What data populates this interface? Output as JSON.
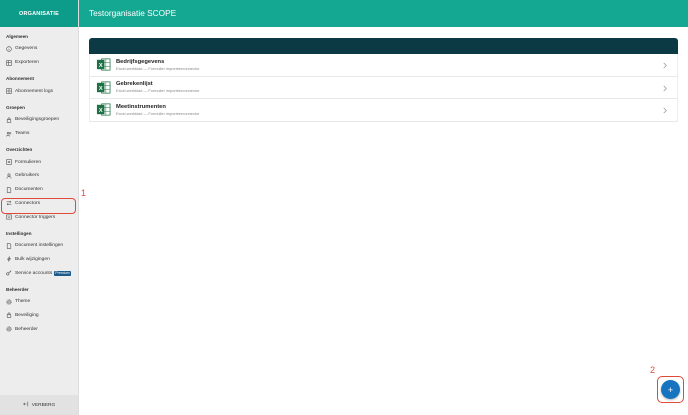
{
  "sidebar": {
    "header": "ORGANISATIE",
    "groups": [
      {
        "title": "Algemeen",
        "items": [
          {
            "label": "Gegevens",
            "icon": "info-icon"
          },
          {
            "label": "Exporteren",
            "icon": "table-icon"
          }
        ]
      },
      {
        "title": "Abonnement",
        "items": [
          {
            "label": "Abonnement logs",
            "icon": "grid-icon"
          }
        ]
      },
      {
        "title": "Groepen",
        "items": [
          {
            "label": "Beveiligingsgroepen",
            "icon": "lock-icon"
          },
          {
            "label": "Teams",
            "icon": "users-icon"
          }
        ]
      },
      {
        "title": "Overzichten",
        "items": [
          {
            "label": "Formulieren",
            "icon": "form-icon"
          },
          {
            "label": "Gebruikers",
            "icon": "user-icon"
          },
          {
            "label": "Documenten",
            "icon": "document-icon"
          },
          {
            "label": "Connectors",
            "icon": "connector-icon"
          },
          {
            "label": "Connector triggers",
            "icon": "trigger-icon"
          }
        ]
      },
      {
        "title": "Instellingen",
        "items": [
          {
            "label": "Document instellingen",
            "icon": "document-icon"
          },
          {
            "label": "Bulk wijzigingen",
            "icon": "bolt-icon"
          },
          {
            "label": "Service accounts",
            "icon": "key-icon",
            "badge": "Premium"
          }
        ]
      },
      {
        "title": "Beheerder",
        "items": [
          {
            "label": "Theme",
            "icon": "gear-icon"
          },
          {
            "label": "Beveiliging",
            "icon": "lock-icon"
          },
          {
            "label": "Beheerder",
            "icon": "gear-icon"
          }
        ]
      }
    ],
    "footer": "VERBERG"
  },
  "header": {
    "title": "Testorganisatie SCOPE"
  },
  "connectors": [
    {
      "title": "Bedrijfsgegevens",
      "subtitle": "Excel-werkblad — Formulier importeerconnector"
    },
    {
      "title": "Gebrekenlijst",
      "subtitle": "Excel-werkblad — Formulier importeerconnector"
    },
    {
      "title": "Meetinstrumenten",
      "subtitle": "Excel-werkblad — Formulier importeerconnector"
    }
  ],
  "annotations": {
    "one": "1",
    "two": "2"
  },
  "fab": {
    "label": "+"
  },
  "colors": {
    "accent": "#14a893",
    "header_dark": "#0b3a44",
    "fab": "#1573bf",
    "annotation": "#e04a3a"
  }
}
